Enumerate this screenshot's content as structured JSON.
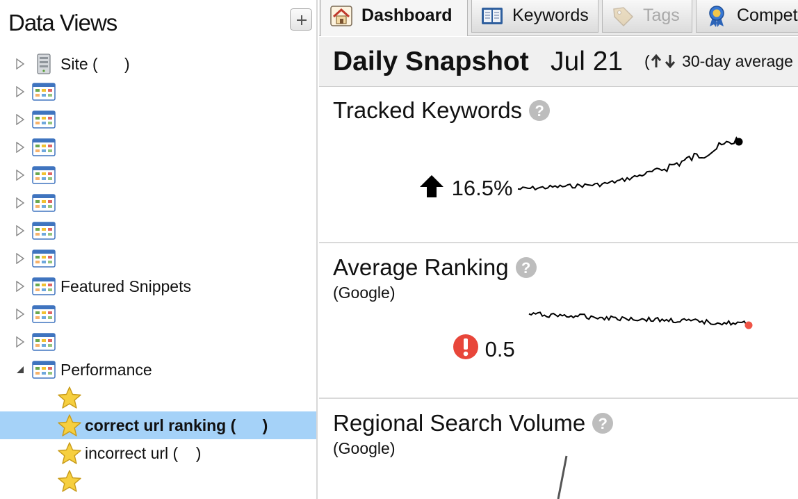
{
  "sidebar": {
    "title": "Data Views",
    "add_button": "+",
    "items": [
      {
        "label": "Site (      )",
        "icon": "server-icon",
        "expanded": false
      },
      {
        "label": "",
        "icon": "grid-icon",
        "expanded": false
      },
      {
        "label": "",
        "icon": "grid-icon",
        "expanded": false
      },
      {
        "label": "",
        "icon": "grid-icon",
        "expanded": false
      },
      {
        "label": "",
        "icon": "grid-icon",
        "expanded": false
      },
      {
        "label": "",
        "icon": "grid-icon",
        "expanded": false
      },
      {
        "label": "",
        "icon": "grid-icon",
        "expanded": false
      },
      {
        "label": "",
        "icon": "grid-icon",
        "expanded": false
      },
      {
        "label": "Featured Snippets",
        "icon": "grid-icon",
        "expanded": false
      },
      {
        "label": "",
        "icon": "grid-icon",
        "expanded": false
      },
      {
        "label": "",
        "icon": "grid-icon",
        "expanded": false
      },
      {
        "label": "Performance",
        "icon": "grid-icon",
        "expanded": true
      }
    ],
    "performance_children": [
      {
        "label": "",
        "icon": "star-icon",
        "selected": false
      },
      {
        "label": "correct url ranking (      )",
        "icon": "star-icon",
        "selected": true
      },
      {
        "label": "incorrect url (    )",
        "icon": "star-icon",
        "selected": false
      },
      {
        "label": "",
        "icon": "star-icon",
        "selected": false
      }
    ]
  },
  "tabs": [
    {
      "label": "Dashboard",
      "icon": "home-icon",
      "active": true,
      "disabled": false
    },
    {
      "label": "Keywords",
      "icon": "book-icon",
      "active": false,
      "disabled": false
    },
    {
      "label": "Tags",
      "icon": "tag-icon",
      "active": false,
      "disabled": true
    },
    {
      "label": "Competit",
      "icon": "ribbon-icon",
      "active": false,
      "disabled": false
    }
  ],
  "snapshot": {
    "title": "Daily Snapshot",
    "date": "Jul 21",
    "legend_prefix": "(",
    "legend_text": "30-day average"
  },
  "cards": {
    "tracked": {
      "title": "Tracked Keywords",
      "help": "?",
      "change": "16.5%",
      "trend": "up-arrow-icon"
    },
    "ranking": {
      "title": "Average Ranking",
      "help": "?",
      "subtitle": "(Google)",
      "change": "0.5",
      "trend": "alert-icon"
    },
    "regional": {
      "title": "Regional Search Volume",
      "help": "?",
      "subtitle": "(Google)"
    }
  },
  "colors": {
    "selected_row": "#a5d2f8",
    "alert_red": "#e8463a",
    "end_dot_ranking": "#ef5547"
  }
}
